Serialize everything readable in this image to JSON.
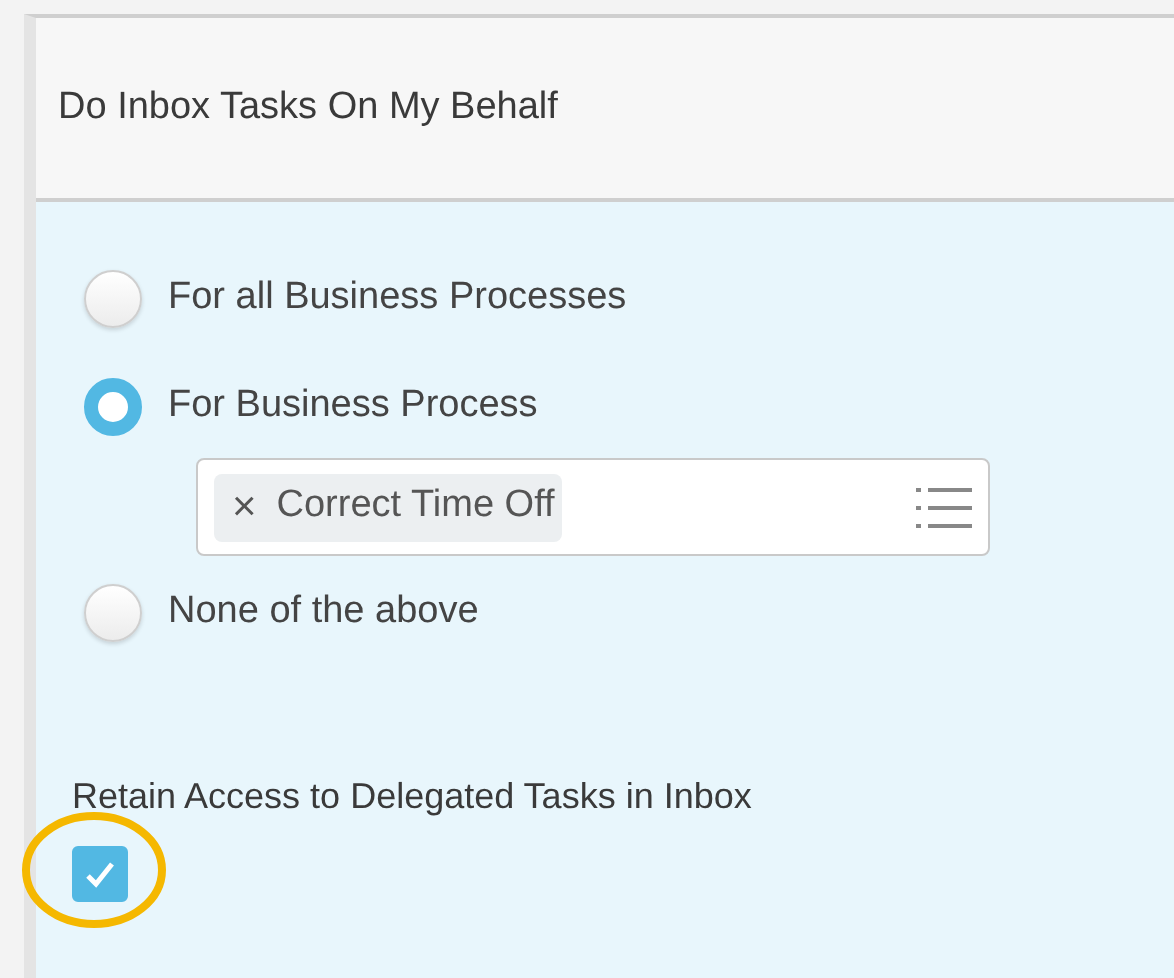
{
  "header": {
    "title": "Do Inbox Tasks On My Behalf"
  },
  "options": [
    {
      "label": "For all Business Processes",
      "selected": false
    },
    {
      "label": "For Business Process",
      "selected": true,
      "field": {
        "tags": [
          {
            "remove": "×",
            "label": "Correct Time Off"
          }
        ]
      }
    },
    {
      "label": "None of the above",
      "selected": false
    }
  ],
  "retain": {
    "label": "Retain Access to Delegated Tasks in Inbox",
    "checked": true,
    "highlighted": true
  }
}
